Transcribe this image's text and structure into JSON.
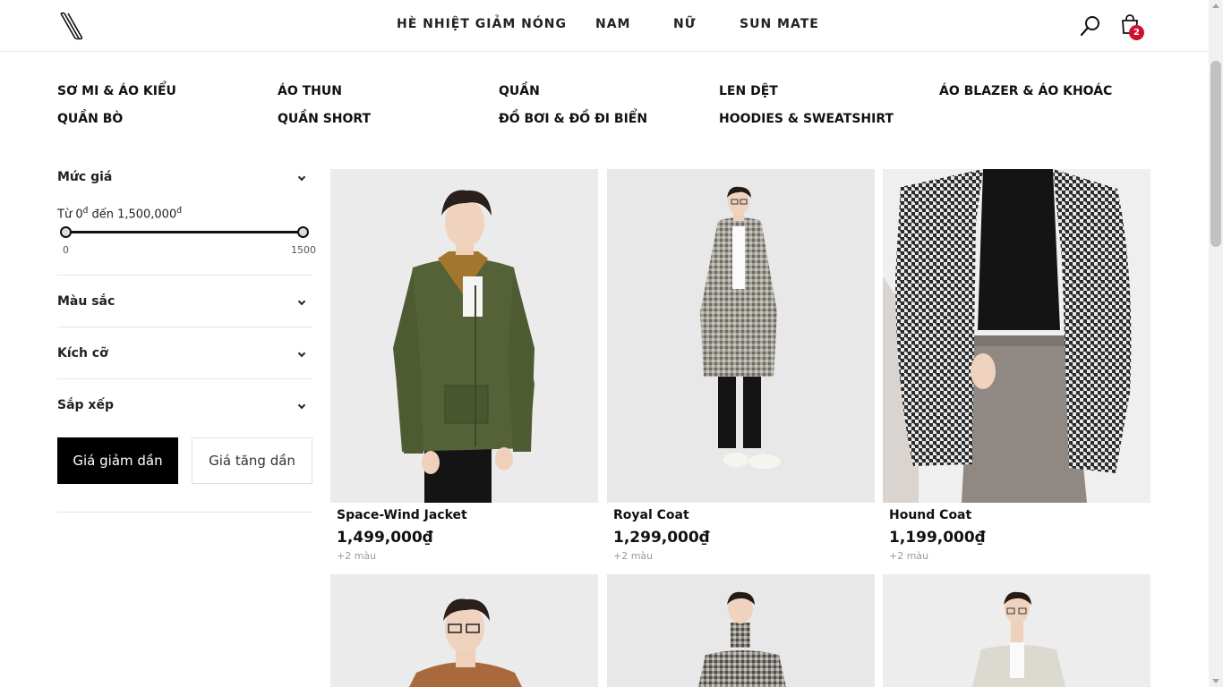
{
  "header": {
    "nav": [
      "HÈ NHIỆT GIẢM NÓNG",
      "NAM",
      "NỮ",
      "SUN MATE"
    ],
    "cart_count": "2"
  },
  "categories": [
    "SƠ MI & ÁO KIỂU",
    "ÁO THUN",
    "QUẦN",
    "LEN DỆT",
    "ÁO BLAZER & ÁO KHOÁC",
    "QUẦN BÒ",
    "QUẦN SHORT",
    "ĐỒ BƠI & ĐỒ ĐI BIỂN",
    "HOODIES & SWEATSHIRT"
  ],
  "filters": {
    "price": {
      "title": "Mức giá",
      "range_from": "Từ 0",
      "range_to": " đến 1,500,000",
      "currency": "đ",
      "min_label": "0",
      "max_label": "1500"
    },
    "color_title": "Màu sắc",
    "size_title": "Kích cỡ",
    "sort_title": "Sắp xếp",
    "sort_desc": "Giá giảm dần",
    "sort_asc": "Giá tăng dần"
  },
  "products": [
    {
      "name": "Space-Wind Jacket",
      "price": "1,499,000₫",
      "colors": "+2 màu"
    },
    {
      "name": "Royal Coat",
      "price": "1,299,000₫",
      "colors": "+2 màu"
    },
    {
      "name": "Hound Coat",
      "price": "1,199,000₫",
      "colors": "+2 màu"
    },
    {
      "name": "",
      "price": "",
      "colors": ""
    },
    {
      "name": "",
      "price": "",
      "colors": ""
    },
    {
      "name": "",
      "price": "",
      "colors": ""
    }
  ],
  "colors": {
    "jacket_green": "#556238",
    "coat_grey": "#8c8a84",
    "houndstooth": "#3a3a3a",
    "camel": "#a8693c",
    "badge_red": "#d0112b"
  }
}
